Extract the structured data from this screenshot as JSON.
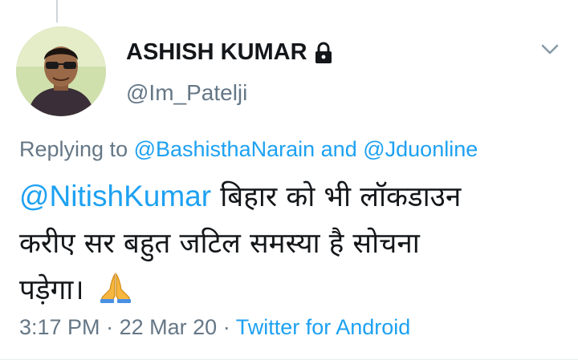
{
  "tweet": {
    "author": {
      "display_name": "ASHISH KUMAR",
      "handle": "@Im_Patelji",
      "protected_icon": "lock-icon",
      "avatar_icon": "profile-photo"
    },
    "menu_icon": "chevron-down-icon",
    "reply_context": {
      "prefix": "Replying to",
      "user1": "@BashisthaNarain",
      "conjunction": "and",
      "user2": "@Jduonline"
    },
    "mention": "@NitishKumar",
    "text_line1": "बिहार को भी लॉकडाउन",
    "text_line2": "करीए सर बहुत जटिल समस्या है सोचना",
    "text_line3": "पड़ेगा।",
    "emoji_icon": "folded-hands-icon",
    "time": "3:17 PM",
    "separator": "·",
    "date": "22 Mar 20",
    "source": "Twitter for Android"
  },
  "colors": {
    "link": "#1da1f2",
    "secondary_text": "#657786",
    "primary_text": "#14171a"
  }
}
